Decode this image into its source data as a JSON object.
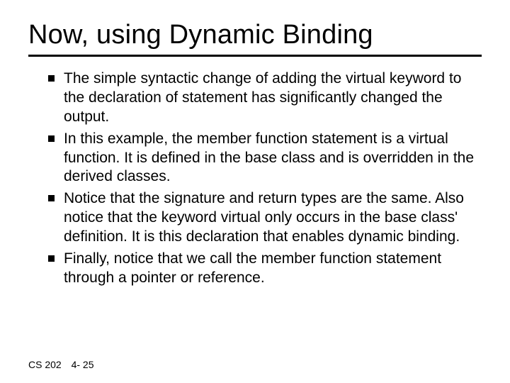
{
  "title": "Now, using Dynamic Binding",
  "bullets": [
    "The simple syntactic change of adding the virtual keyword to the declaration of statement has significantly changed the output.",
    "In this example, the member function statement is a virtual function. It is defined in the base class and is overridden in the derived classes.",
    "Notice that the signature and return types are the same. Also notice that the keyword virtual only occurs in the base class' definition. It is this declaration that enables dynamic binding.",
    "Finally, notice that we call the member function statement through a pointer or reference."
  ],
  "footer": {
    "course": "CS 202",
    "page": "4- 25"
  }
}
